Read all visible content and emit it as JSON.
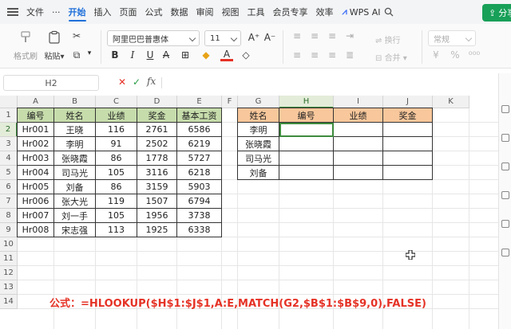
{
  "menu": {
    "file": "文件",
    "more": "···",
    "tabs": [
      "开始",
      "插入",
      "页面",
      "公式",
      "数据",
      "审阅",
      "视图",
      "工具",
      "会员专享",
      "效率"
    ],
    "active_tab": "开始",
    "wps_ai": "WPS AI",
    "share": "分享"
  },
  "ribbon": {
    "format_painter": "格式刷",
    "paste": "粘贴",
    "font_name": "阿里巴巴普惠体",
    "font_size": "11",
    "wrap": "换行",
    "merge": "合并",
    "number_format": "常规"
  },
  "formula_bar": {
    "name_box": "H2",
    "fx": "fx",
    "content": ""
  },
  "grid": {
    "columns": [
      "A",
      "B",
      "C",
      "D",
      "E",
      "F",
      "G",
      "H",
      "I",
      "J",
      "K"
    ],
    "rows": [
      "1",
      "2",
      "3",
      "4",
      "5",
      "6",
      "7",
      "8",
      "9",
      "10",
      "11",
      "12",
      "13",
      "14"
    ],
    "selected_column": "H",
    "selected_row": "2"
  },
  "source_table": {
    "headers": [
      "编号",
      "姓名",
      "业绩",
      "奖金",
      "基本工资"
    ],
    "rows": [
      [
        "Hr001",
        "王晓",
        "116",
        "2761",
        "6586"
      ],
      [
        "Hr002",
        "李明",
        "91",
        "2502",
        "6219"
      ],
      [
        "Hr003",
        "张晓霞",
        "86",
        "1778",
        "5727"
      ],
      [
        "Hr004",
        "司马光",
        "105",
        "3116",
        "6218"
      ],
      [
        "Hr005",
        "刘备",
        "86",
        "3159",
        "5903"
      ],
      [
        "Hr006",
        "张大光",
        "119",
        "1507",
        "6794"
      ],
      [
        "Hr007",
        "刘一手",
        "105",
        "1956",
        "3738"
      ],
      [
        "Hr008",
        "宋志强",
        "113",
        "1925",
        "6338"
      ]
    ]
  },
  "lookup_table": {
    "headers": [
      "姓名",
      "编号",
      "业绩",
      "奖金"
    ],
    "names": [
      "李明",
      "张晓霞",
      "司马光",
      "刘备"
    ]
  },
  "formula_note": "公式：=HLOOKUP($H$1:$J$1,A:E,MATCH(G2,$B$1:$B$9,0),FALSE)",
  "colors": {
    "header_green": "#c6dcab",
    "header_orange": "#f8c79b",
    "accent_blue": "#1e6fd9",
    "share_green": "#18a058",
    "formula_red": "#e53226"
  }
}
